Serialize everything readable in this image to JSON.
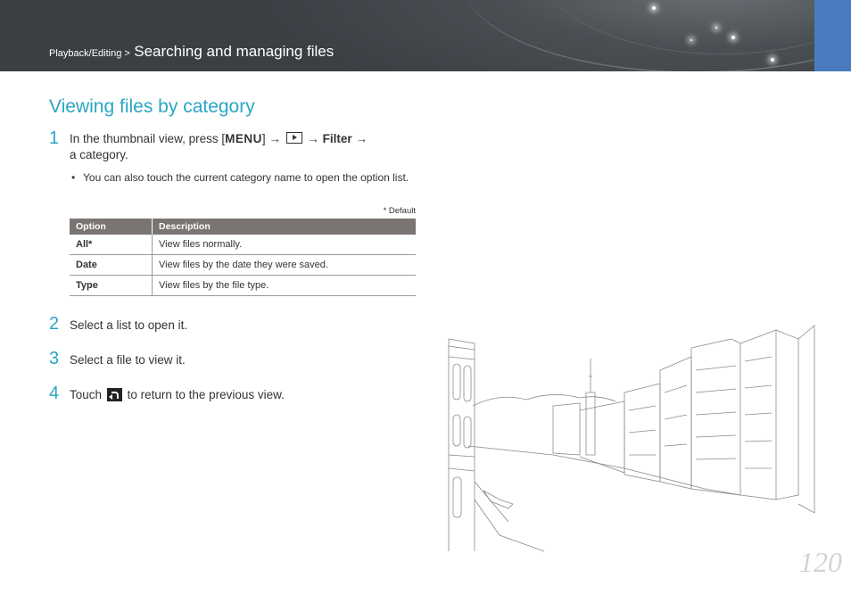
{
  "header": {
    "breadcrumb_prefix": "Playback/Editing >",
    "breadcrumb_title": "Searching and managing files",
    "accent_color": "#4a7bbf"
  },
  "section": {
    "title": "Viewing files by category"
  },
  "steps": [
    {
      "number": "1",
      "text_before_menu": "In the thumbnail view, press [",
      "menu_word": "MENU",
      "text_after_menu": "] →",
      "arrow2": "→",
      "filter_label": "Filter",
      "arrow3": "→",
      "line2": "a category.",
      "bullet": "You can also touch the current category name to open the option list."
    },
    {
      "number": "2",
      "text": "Select a list to open it."
    },
    {
      "number": "3",
      "text": "Select a file to view it."
    },
    {
      "number": "4",
      "text_before": "Touch",
      "text_after": "to return to the previous view."
    }
  ],
  "table": {
    "default_note": "* Default",
    "headers": [
      "Option",
      "Description"
    ],
    "rows": [
      {
        "option": "All*",
        "description": "View files normally."
      },
      {
        "option": "Date",
        "description": "View files by the date they were saved."
      },
      {
        "option": "Type",
        "description": "View files by the file type."
      }
    ]
  },
  "page_number": "120",
  "icons": {
    "menu": "menu-button-icon",
    "play": "playback-icon",
    "back": "back-icon"
  }
}
